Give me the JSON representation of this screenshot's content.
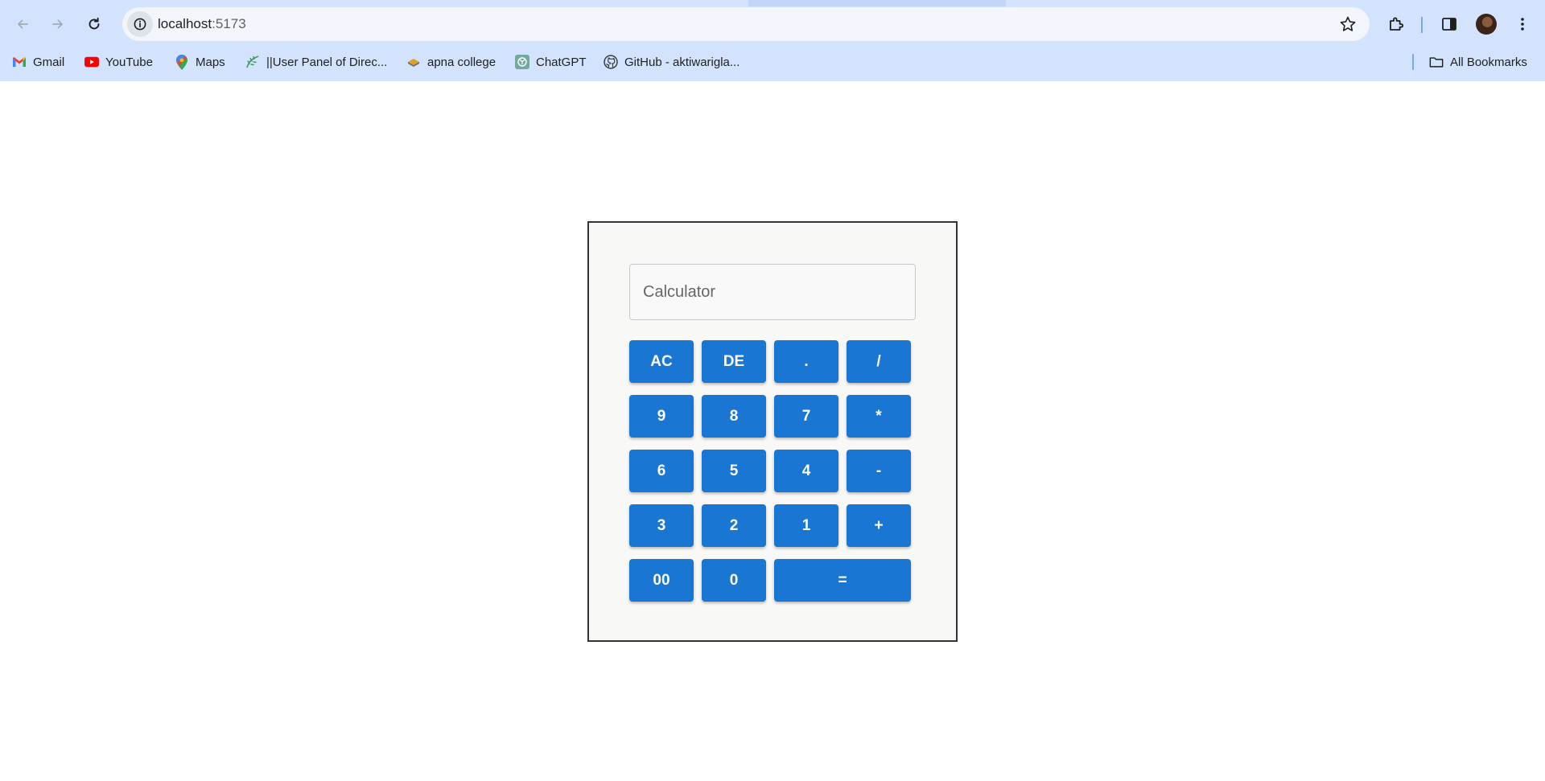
{
  "browser": {
    "url_host": "localhost",
    "url_port": ":5173",
    "bookmarks": [
      {
        "label": "Gmail",
        "icon": "gmail-icon"
      },
      {
        "label": "YouTube",
        "icon": "youtube-icon"
      },
      {
        "label": "Maps",
        "icon": "maps-icon"
      },
      {
        "label": "||User Panel of Direc...",
        "icon": "leaf-icon"
      },
      {
        "label": "apna college",
        "icon": "apna-college-icon"
      },
      {
        "label": "ChatGPT",
        "icon": "chatgpt-icon"
      },
      {
        "label": "GitHub - aktiwarigla...",
        "icon": "github-icon"
      }
    ],
    "all_bookmarks_label": "All Bookmarks",
    "colors": {
      "chrome_bg": "#d3e3fd",
      "omnibox_bg": "#f2f6fc"
    }
  },
  "calculator": {
    "placeholder": "Calculator",
    "colors": {
      "key_bg": "#1976d2",
      "key_text": "#ffffff",
      "panel_bg": "#f8f8f6"
    },
    "keys": [
      "AC",
      "DE",
      ".",
      "/",
      "9",
      "8",
      "7",
      "*",
      "6",
      "5",
      "4",
      "-",
      "3",
      "2",
      "1",
      "+",
      "00",
      "0",
      "="
    ]
  }
}
